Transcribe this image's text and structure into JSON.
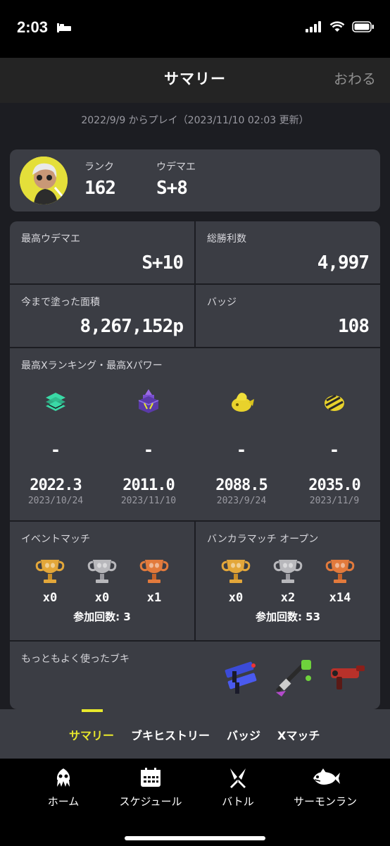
{
  "status_bar": {
    "time": "2:03"
  },
  "header": {
    "title": "サマリー",
    "close_label": "おわる"
  },
  "play_info": "2022/9/9 からプレイ（2023/11/10 02:03 更新）",
  "profile": {
    "rank_label": "ランク",
    "rank_value": "162",
    "udemae_label": "ウデマエ",
    "udemae_value": "S+8"
  },
  "stats": {
    "max_udemae_label": "最高ウデマエ",
    "max_udemae_value": "S+10",
    "total_wins_label": "総勝利数",
    "total_wins_value": "4,997",
    "painted_label": "今まで塗った面積",
    "painted_value": "8,267,152p",
    "badges_label": "バッジ",
    "badges_value": "108"
  },
  "x_ranking": {
    "label": "最高Xランキング・最高Xパワー",
    "columns": [
      {
        "icon": "tower-icon",
        "rank": "-",
        "power": "2022.3",
        "date": "2023/10/24"
      },
      {
        "icon": "splat-zones-icon",
        "rank": "-",
        "power": "2011.0",
        "date": "2023/11/10"
      },
      {
        "icon": "rainmaker-icon",
        "rank": "-",
        "power": "2088.5",
        "date": "2023/9/24"
      },
      {
        "icon": "clam-icon",
        "rank": "-",
        "power": "2035.0",
        "date": "2023/11/9"
      }
    ]
  },
  "event_match": {
    "label": "イベントマッチ",
    "trophies": [
      {
        "icon": "gold-trophy-icon",
        "count": "x0"
      },
      {
        "icon": "silver-trophy-icon",
        "count": "x0"
      },
      {
        "icon": "bronze-trophy-icon",
        "count": "x1"
      }
    ],
    "participation": "参加回数: 3"
  },
  "bankara_open": {
    "label": "バンカラマッチ オープン",
    "trophies": [
      {
        "icon": "gold-trophy-icon",
        "count": "x0"
      },
      {
        "icon": "silver-trophy-icon",
        "count": "x2"
      },
      {
        "icon": "bronze-trophy-icon",
        "count": "x14"
      }
    ],
    "participation": "参加回数: 53"
  },
  "most_used": {
    "label": "もっともよく使ったブキ"
  },
  "tabs": [
    "サマリー",
    "ブキヒストリー",
    "バッジ",
    "Xマッチ"
  ],
  "bottom_nav": [
    "ホーム",
    "スケジュール",
    "バトル",
    "サーモンラン"
  ],
  "colors": {
    "accent": "#e8e82c",
    "card": "#3b3d44",
    "background": "#1c1d22",
    "gold": "#e3a73a",
    "silver": "#b8b8bc",
    "bronze": "#e27a3c"
  }
}
